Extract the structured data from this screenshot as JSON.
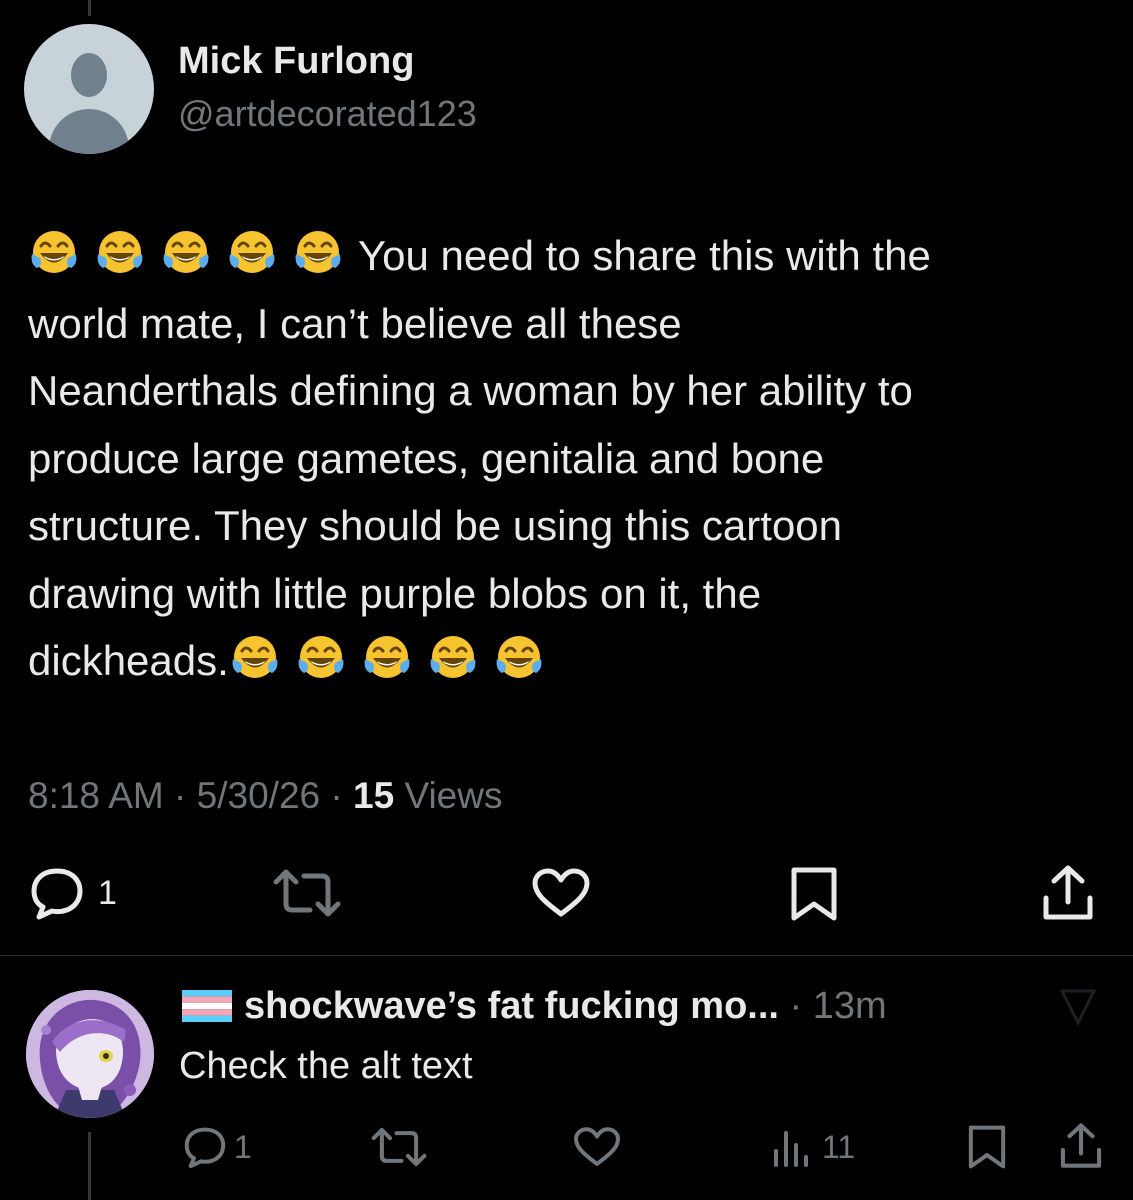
{
  "tweet": {
    "author_name": "Mick Furlong",
    "author_handle": "@artdecorated123",
    "text_line_1": "You need to share this with the",
    "text_line_2": "world mate, I can’t believe all these",
    "text_line_3": "Neanderthals defining a woman by her ability to",
    "text_line_4": "produce large gametes, genitalia and bone",
    "text_line_5": "structure. They should be using this cartoon",
    "text_line_6": "drawing with little purple blobs on it, the",
    "text_line_7": "dickheads.",
    "leading_emoji": "face-with-tears-of-joy x5",
    "trailing_emoji": "face-with-tears-of-joy x5",
    "time": "8:18 AM",
    "date": "5/30/26",
    "views_count": "15",
    "views_label": "Views",
    "reply_count": "1"
  },
  "reply": {
    "author_name": "shockwave’s fat fucking mo...",
    "flag_icon": "transgender-flag",
    "time": "13m",
    "text": "Check the alt text",
    "reply_count": "1",
    "views_count": "11"
  },
  "colors": {
    "background": "#000000",
    "primary_text": "#e7e9ea",
    "secondary_text": "#71767b",
    "divider": "#2f3336"
  }
}
